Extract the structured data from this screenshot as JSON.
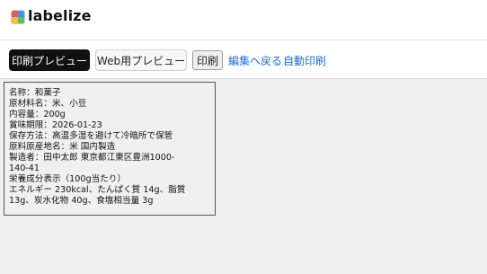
{
  "app": {
    "brand": "labelize"
  },
  "toolbar": {
    "print_preview_label": "印刷プレビュー",
    "web_preview_label": "Web用プレビュー",
    "print_label": "印刷",
    "edit_back_label": "編集へ戻る",
    "auto_print_label": "自動印刷"
  },
  "label": {
    "lines": [
      "名称：和菓子",
      "原材料名：米、小豆",
      "内容量：200g",
      "賞味期限：2026-01-23",
      "保存方法：高温多湿を避けて冷暗所で保管",
      "原料原産地名：米 国内製造",
      "製造者：田中太郎 東京都江東区豊洲1000-",
      "140-41",
      "栄養成分表示（100g当たり）",
      "エネルギー 230kcal、たんぱく質 14g、脂質",
      "13g、炭水化物 40g、食塩相当量 3g"
    ]
  },
  "colors": {
    "link": "#1a6fd6",
    "primary_button": "#111111",
    "background": "#efefef"
  }
}
